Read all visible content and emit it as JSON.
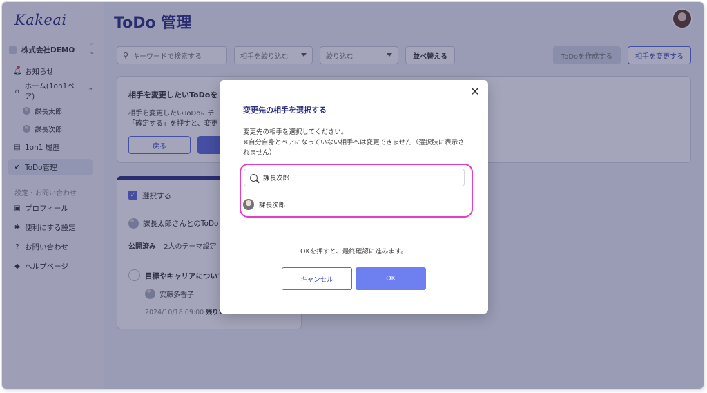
{
  "app": {
    "logo": "Kakeai",
    "page_title": "ToDo 管理"
  },
  "sidebar": {
    "company": "株式会社DEMO",
    "items": [
      {
        "label": "お知らせ",
        "icon": "bell-icon"
      },
      {
        "label": "ホーム(1on1ペア)",
        "icon": "home-icon"
      },
      {
        "label": "課長太郎",
        "icon": "avatar"
      },
      {
        "label": "課長次郎",
        "icon": "avatar"
      },
      {
        "label": "1on1 履歴",
        "icon": "history-icon"
      },
      {
        "label": "ToDo管理",
        "icon": "check-circle-icon"
      }
    ],
    "section_label": "設定・お問い合わせ",
    "settings": [
      {
        "label": "プロフィール",
        "icon": "profile-icon"
      },
      {
        "label": "便利にする設定",
        "icon": "gear-icon"
      },
      {
        "label": "お問い合わせ",
        "icon": "help-icon"
      },
      {
        "label": "ヘルプページ",
        "icon": "graduation-cap-icon"
      }
    ]
  },
  "toolbar": {
    "search_placeholder": "キーワードで検索する",
    "filter_partner": "相手を絞り込む",
    "filter": "絞り込む",
    "sort": "並べ替える",
    "create": "ToDoを作成する",
    "change_partner": "相手を変更する"
  },
  "panel": {
    "title": "相手を変更したいToDoを",
    "desc": "相手を変更したいToDoにチ\n「確定する」を押すと、変更",
    "back": "戻る"
  },
  "card": {
    "select_label": "選択する",
    "todo_with": "課長太郎さんとのToDo",
    "status": "公開済み",
    "theme": "2人のテーマ設定",
    "item_title": "目標やキャリアについて",
    "assignee": "安藤多香子",
    "date": "2024/10/18 09:00",
    "remaining": "残り1"
  },
  "modal": {
    "title": "変更先の相手を選択する",
    "desc_line1": "変更先の相手を選択してください。",
    "desc_line2": "※自分自身とペアになっていない相手へは変更できません（選択肢に表示されません）",
    "search_value": "課長次郎",
    "result": "課長次郎",
    "note": "OKを押すと、最終確認に進みます。",
    "cancel": "キャンセル",
    "ok": "OK"
  },
  "colors": {
    "brand": "#2e2f80",
    "accent": "#5b6ad6",
    "highlight": "#e83cc5",
    "ok_button": "#6e7ff0"
  }
}
